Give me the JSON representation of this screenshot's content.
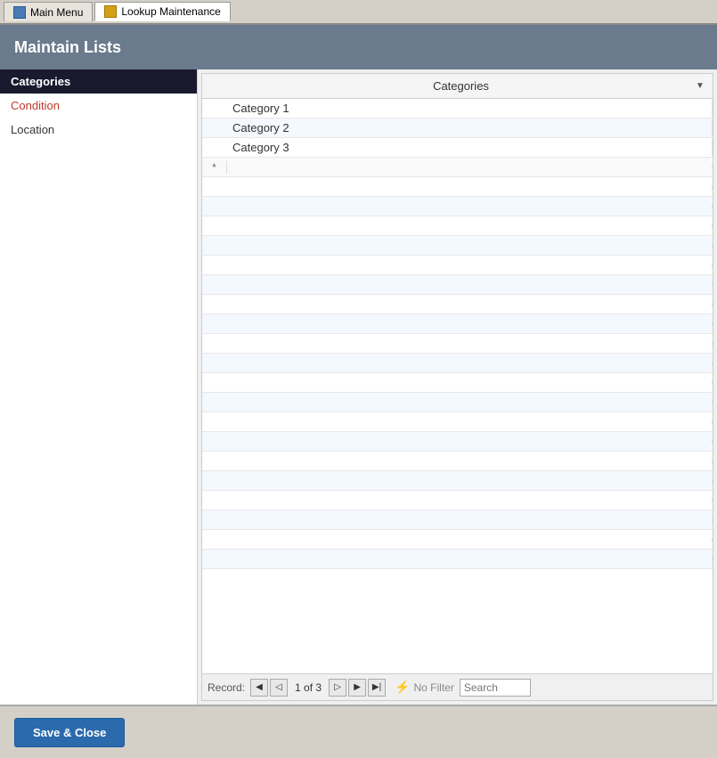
{
  "tabs": [
    {
      "id": "main-menu",
      "label": "Main Menu",
      "icon": "main-icon",
      "active": false
    },
    {
      "id": "lookup-maintenance",
      "label": "Lookup Maintenance",
      "icon": "lookup-icon",
      "active": true
    }
  ],
  "page": {
    "title": "Maintain Lists"
  },
  "left_panel": {
    "items": [
      {
        "id": "categories",
        "label": "Categories",
        "selected": true
      },
      {
        "id": "condition",
        "label": "Condition",
        "selected": false,
        "style": "condition"
      },
      {
        "id": "location",
        "label": "Location",
        "selected": false
      }
    ]
  },
  "grid": {
    "column_header": "Categories",
    "dropdown_symbol": "▼",
    "rows": [
      {
        "indicator": "",
        "value": "Category 1"
      },
      {
        "indicator": "",
        "value": "Category 2"
      },
      {
        "indicator": "",
        "value": "Category 3"
      }
    ],
    "new_row_indicator": "*"
  },
  "nav": {
    "record_label": "Record:",
    "first_symbol": "◀",
    "prev_symbol": "◁",
    "record_info": "1 of 3",
    "next_symbol": "▷",
    "last_symbol": "▶",
    "last_new_symbol": "▶|",
    "filter_icon": "🔍",
    "filter_text": "No Filter",
    "search_placeholder": "Search"
  },
  "footer": {
    "save_close_label": "Save & Close"
  }
}
